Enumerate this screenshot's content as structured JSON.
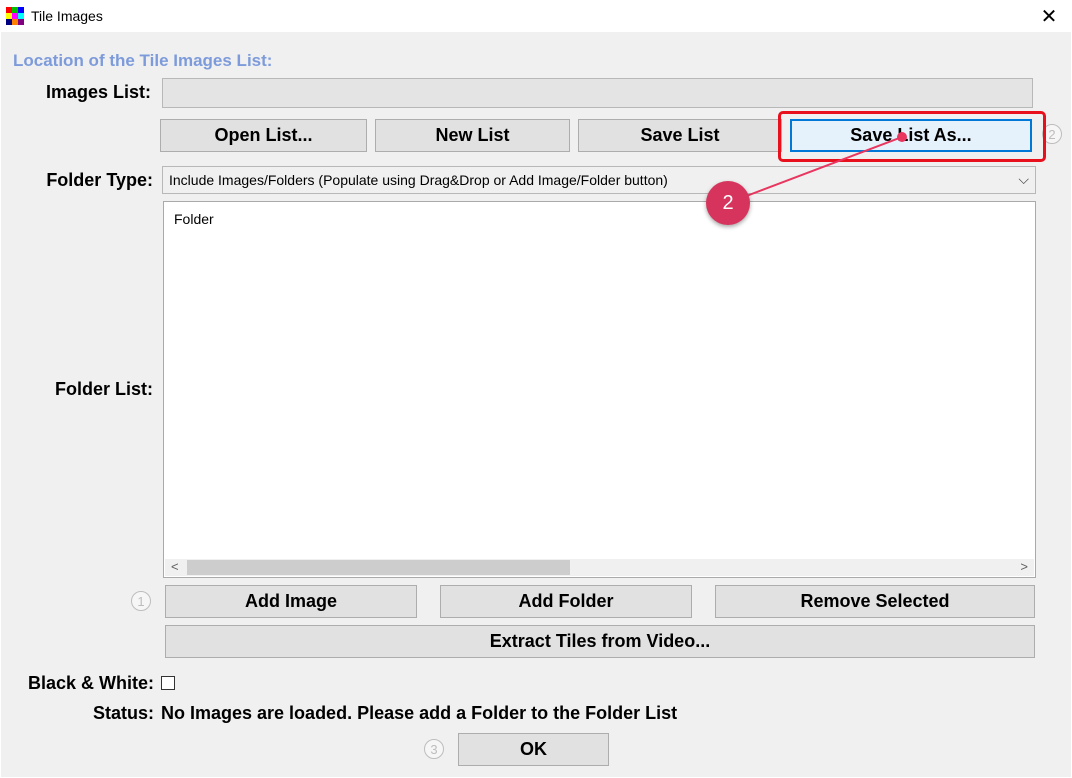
{
  "window": {
    "title": "Tile Images",
    "close_glyph": "✕"
  },
  "app_icon": {
    "name": "tile-images-app-icon",
    "colors": [
      "#ff0000",
      "#00c000",
      "#0000ff",
      "#ffff00",
      "#ff00ff",
      "#00ffff",
      "#000080",
      "#ff8000",
      "#800080"
    ]
  },
  "header": {
    "section_title": "Location of the Tile Images List:",
    "accent_color": "#7d9bdb"
  },
  "images_list": {
    "label": "Images List:",
    "value": ""
  },
  "list_buttons": {
    "open": "Open List...",
    "new": "New List",
    "save": "Save List",
    "save_as": "Save List As..."
  },
  "folder_type": {
    "label": "Folder Type:",
    "selected": "Include Images/Folders (Populate using Drag&Drop or Add Image/Folder button)"
  },
  "folder_list": {
    "label": "Folder List:",
    "items": [
      "Folder"
    ],
    "scroll_left": "<",
    "scroll_right": ">"
  },
  "folder_buttons": {
    "add_image": "Add Image",
    "add_folder": "Add Folder",
    "remove_selected": "Remove Selected",
    "extract_video": "Extract Tiles from Video..."
  },
  "options": {
    "black_white_label": "Black & White:",
    "black_white_checked": false
  },
  "status": {
    "label": "Status:",
    "text": "No Images are loaded. Please add a Folder to the Folder List"
  },
  "ok_button": "OK",
  "steps": {
    "step1": "1",
    "step2": "2",
    "step3": "3"
  },
  "annotation": {
    "marker_label": "2",
    "highlight_color": "#e8101c",
    "marker_color": "#d6345c"
  }
}
